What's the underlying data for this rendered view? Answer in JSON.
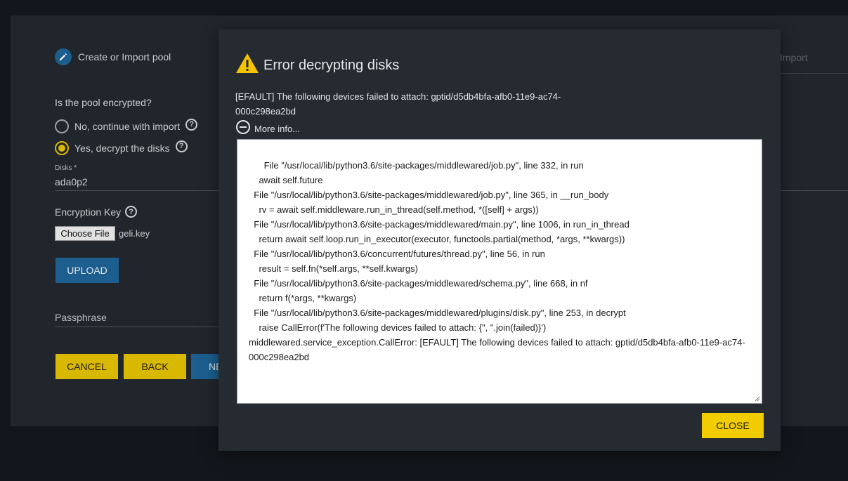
{
  "wizard": {
    "step1_label": "Create or Import pool",
    "step_import_label": "Import",
    "encrypted_question": "Is the pool encrypted?",
    "option_no": "No, continue with import",
    "option_yes": "Yes, decrypt the disks",
    "selected_option": "yes",
    "disks_label": "Disks *",
    "disks_value": "ada0p2",
    "encryption_key_label": "Encryption Key",
    "choose_file_label": "Choose File",
    "file_name": "geli.key",
    "upload_label": "UPLOAD",
    "passphrase_placeholder": "Passphrase",
    "cancel_label": "CANCEL",
    "back_label": "BACK",
    "next_label": "NE"
  },
  "dialog": {
    "title": "Error decrypting disks",
    "message": "[EFAULT] The following devices failed to attach: gptid/d5db4bfa-afb0-11e9-ac74-000c298ea2bd",
    "more_info_label": "More info...",
    "traceback": "  File \"/usr/local/lib/python3.6/site-packages/middlewared/job.py\", line 332, in run\n    await self.future\n  File \"/usr/local/lib/python3.6/site-packages/middlewared/job.py\", line 365, in __run_body\n    rv = await self.middleware.run_in_thread(self.method, *([self] + args))\n  File \"/usr/local/lib/python3.6/site-packages/middlewared/main.py\", line 1006, in run_in_thread\n    return await self.loop.run_in_executor(executor, functools.partial(method, *args, **kwargs))\n  File \"/usr/local/lib/python3.6/concurrent/futures/thread.py\", line 56, in run\n    result = self.fn(*self.args, **self.kwargs)\n  File \"/usr/local/lib/python3.6/site-packages/middlewared/schema.py\", line 668, in nf\n    return f(*args, **kwargs)\n  File \"/usr/local/lib/python3.6/site-packages/middlewared/plugins/disk.py\", line 253, in decrypt\n    raise CallError(f'The following devices failed to attach: {\", \".join(failed)}')\nmiddlewared.service_exception.CallError: [EFAULT] The following devices failed to attach: gptid/d5db4bfa-afb0-11e9-ac74-000c298ea2bd",
    "close_label": "CLOSE"
  },
  "colors": {
    "accent_yellow": "#f0cc00",
    "primary_blue": "#1c5f8f",
    "warning_icon": "#f5c400"
  }
}
